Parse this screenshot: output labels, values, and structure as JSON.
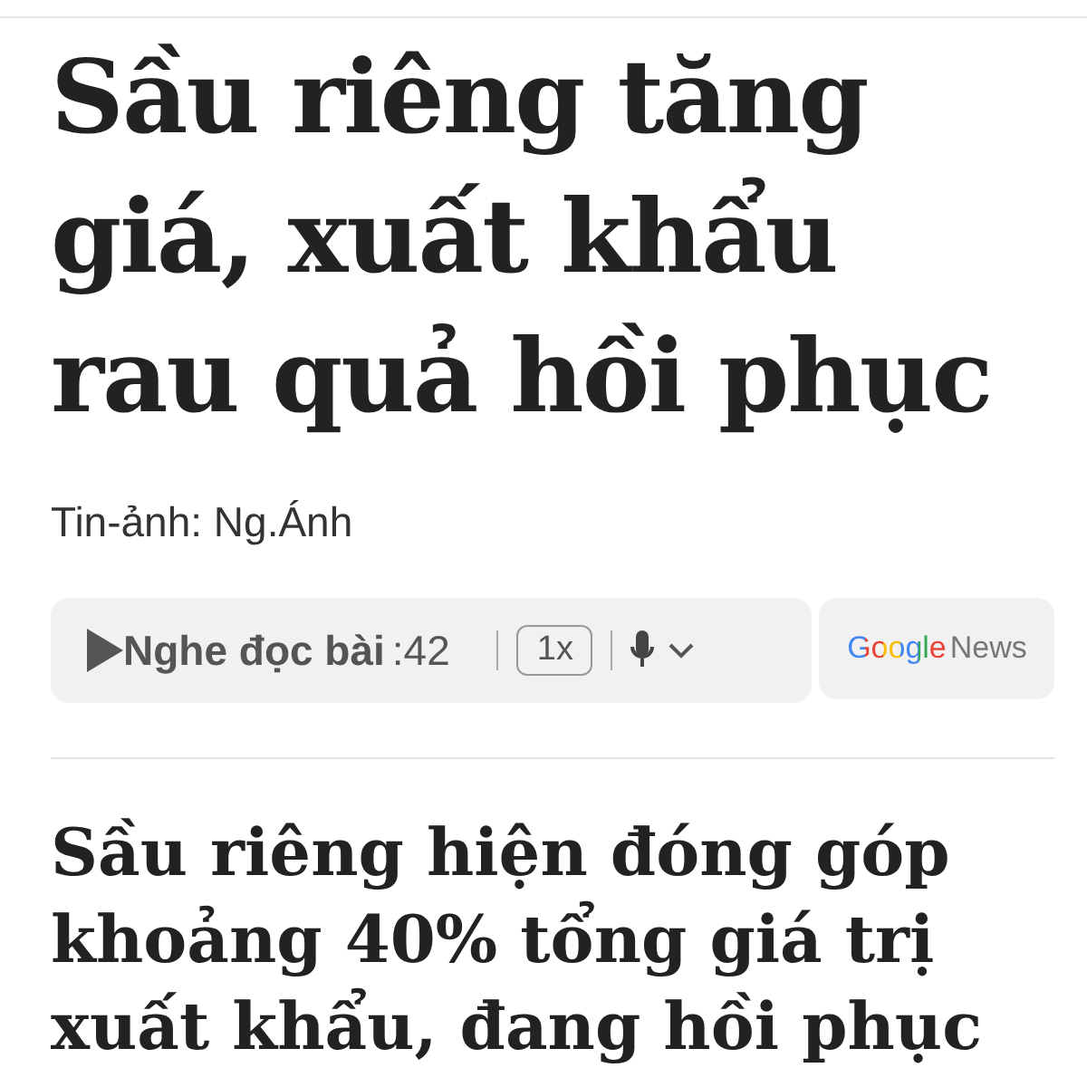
{
  "headline": "Sầu riêng tăng giá, xuất khẩu rau quả hồi phục",
  "byline": "Tin-ảnh: Ng.Ánh",
  "audio_player": {
    "label": "Nghe đọc bài",
    "duration": ":42",
    "speed": "1x"
  },
  "news_badge": {
    "brand": "Google",
    "product": "News"
  },
  "lead": "Sầu riêng hiện đóng góp khoảng 40% tổng giá trị xuất khẩu, đang hồi phục"
}
